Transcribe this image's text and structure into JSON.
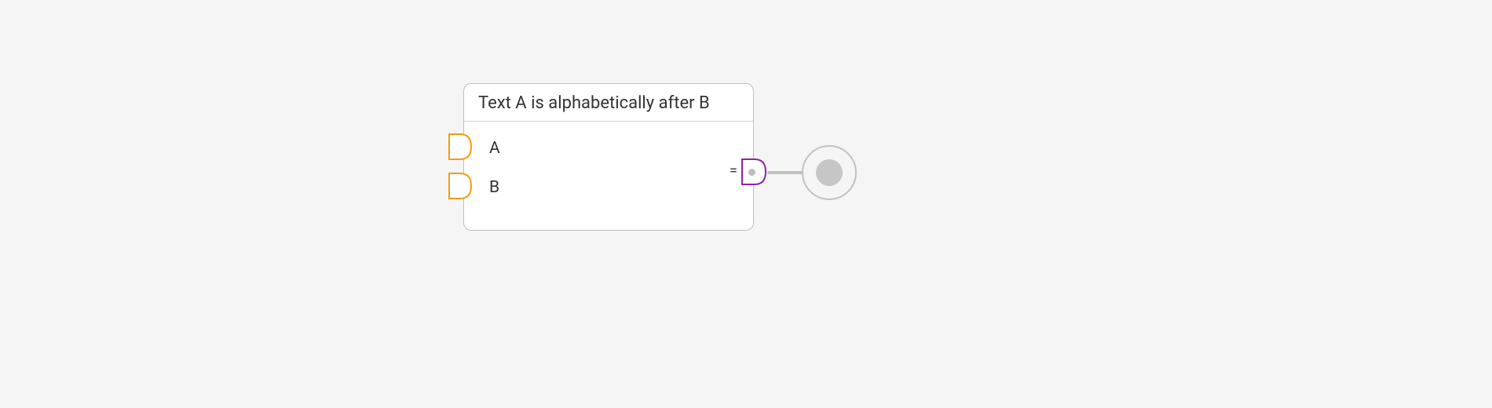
{
  "node": {
    "title": "Text A is alphabetically after B",
    "inputs": [
      {
        "label": "A"
      },
      {
        "label": "B"
      }
    ],
    "output": {
      "prefix": "="
    }
  },
  "colors": {
    "input_port_stroke": "#f59e0b",
    "output_port_stroke": "#8e24aa",
    "connector": "#c1c1c1"
  }
}
